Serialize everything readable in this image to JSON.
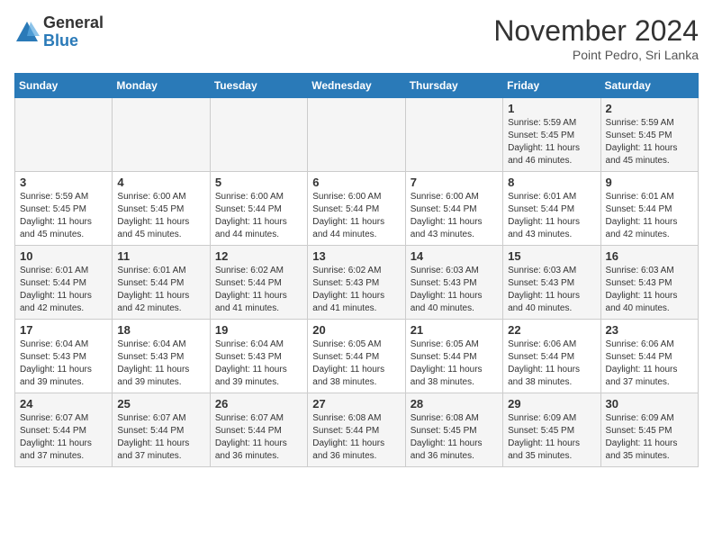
{
  "header": {
    "logo_general": "General",
    "logo_blue": "Blue",
    "month_title": "November 2024",
    "location": "Point Pedro, Sri Lanka"
  },
  "weekdays": [
    "Sunday",
    "Monday",
    "Tuesday",
    "Wednesday",
    "Thursday",
    "Friday",
    "Saturday"
  ],
  "weeks": [
    [
      {
        "day": "",
        "detail": ""
      },
      {
        "day": "",
        "detail": ""
      },
      {
        "day": "",
        "detail": ""
      },
      {
        "day": "",
        "detail": ""
      },
      {
        "day": "",
        "detail": ""
      },
      {
        "day": "1",
        "detail": "Sunrise: 5:59 AM\nSunset: 5:45 PM\nDaylight: 11 hours and 46 minutes."
      },
      {
        "day": "2",
        "detail": "Sunrise: 5:59 AM\nSunset: 5:45 PM\nDaylight: 11 hours and 45 minutes."
      }
    ],
    [
      {
        "day": "3",
        "detail": "Sunrise: 5:59 AM\nSunset: 5:45 PM\nDaylight: 11 hours and 45 minutes."
      },
      {
        "day": "4",
        "detail": "Sunrise: 6:00 AM\nSunset: 5:45 PM\nDaylight: 11 hours and 45 minutes."
      },
      {
        "day": "5",
        "detail": "Sunrise: 6:00 AM\nSunset: 5:44 PM\nDaylight: 11 hours and 44 minutes."
      },
      {
        "day": "6",
        "detail": "Sunrise: 6:00 AM\nSunset: 5:44 PM\nDaylight: 11 hours and 44 minutes."
      },
      {
        "day": "7",
        "detail": "Sunrise: 6:00 AM\nSunset: 5:44 PM\nDaylight: 11 hours and 43 minutes."
      },
      {
        "day": "8",
        "detail": "Sunrise: 6:01 AM\nSunset: 5:44 PM\nDaylight: 11 hours and 43 minutes."
      },
      {
        "day": "9",
        "detail": "Sunrise: 6:01 AM\nSunset: 5:44 PM\nDaylight: 11 hours and 42 minutes."
      }
    ],
    [
      {
        "day": "10",
        "detail": "Sunrise: 6:01 AM\nSunset: 5:44 PM\nDaylight: 11 hours and 42 minutes."
      },
      {
        "day": "11",
        "detail": "Sunrise: 6:01 AM\nSunset: 5:44 PM\nDaylight: 11 hours and 42 minutes."
      },
      {
        "day": "12",
        "detail": "Sunrise: 6:02 AM\nSunset: 5:44 PM\nDaylight: 11 hours and 41 minutes."
      },
      {
        "day": "13",
        "detail": "Sunrise: 6:02 AM\nSunset: 5:43 PM\nDaylight: 11 hours and 41 minutes."
      },
      {
        "day": "14",
        "detail": "Sunrise: 6:03 AM\nSunset: 5:43 PM\nDaylight: 11 hours and 40 minutes."
      },
      {
        "day": "15",
        "detail": "Sunrise: 6:03 AM\nSunset: 5:43 PM\nDaylight: 11 hours and 40 minutes."
      },
      {
        "day": "16",
        "detail": "Sunrise: 6:03 AM\nSunset: 5:43 PM\nDaylight: 11 hours and 40 minutes."
      }
    ],
    [
      {
        "day": "17",
        "detail": "Sunrise: 6:04 AM\nSunset: 5:43 PM\nDaylight: 11 hours and 39 minutes."
      },
      {
        "day": "18",
        "detail": "Sunrise: 6:04 AM\nSunset: 5:43 PM\nDaylight: 11 hours and 39 minutes."
      },
      {
        "day": "19",
        "detail": "Sunrise: 6:04 AM\nSunset: 5:43 PM\nDaylight: 11 hours and 39 minutes."
      },
      {
        "day": "20",
        "detail": "Sunrise: 6:05 AM\nSunset: 5:44 PM\nDaylight: 11 hours and 38 minutes."
      },
      {
        "day": "21",
        "detail": "Sunrise: 6:05 AM\nSunset: 5:44 PM\nDaylight: 11 hours and 38 minutes."
      },
      {
        "day": "22",
        "detail": "Sunrise: 6:06 AM\nSunset: 5:44 PM\nDaylight: 11 hours and 38 minutes."
      },
      {
        "day": "23",
        "detail": "Sunrise: 6:06 AM\nSunset: 5:44 PM\nDaylight: 11 hours and 37 minutes."
      }
    ],
    [
      {
        "day": "24",
        "detail": "Sunrise: 6:07 AM\nSunset: 5:44 PM\nDaylight: 11 hours and 37 minutes."
      },
      {
        "day": "25",
        "detail": "Sunrise: 6:07 AM\nSunset: 5:44 PM\nDaylight: 11 hours and 37 minutes."
      },
      {
        "day": "26",
        "detail": "Sunrise: 6:07 AM\nSunset: 5:44 PM\nDaylight: 11 hours and 36 minutes."
      },
      {
        "day": "27",
        "detail": "Sunrise: 6:08 AM\nSunset: 5:44 PM\nDaylight: 11 hours and 36 minutes."
      },
      {
        "day": "28",
        "detail": "Sunrise: 6:08 AM\nSunset: 5:45 PM\nDaylight: 11 hours and 36 minutes."
      },
      {
        "day": "29",
        "detail": "Sunrise: 6:09 AM\nSunset: 5:45 PM\nDaylight: 11 hours and 35 minutes."
      },
      {
        "day": "30",
        "detail": "Sunrise: 6:09 AM\nSunset: 5:45 PM\nDaylight: 11 hours and 35 minutes."
      }
    ]
  ]
}
